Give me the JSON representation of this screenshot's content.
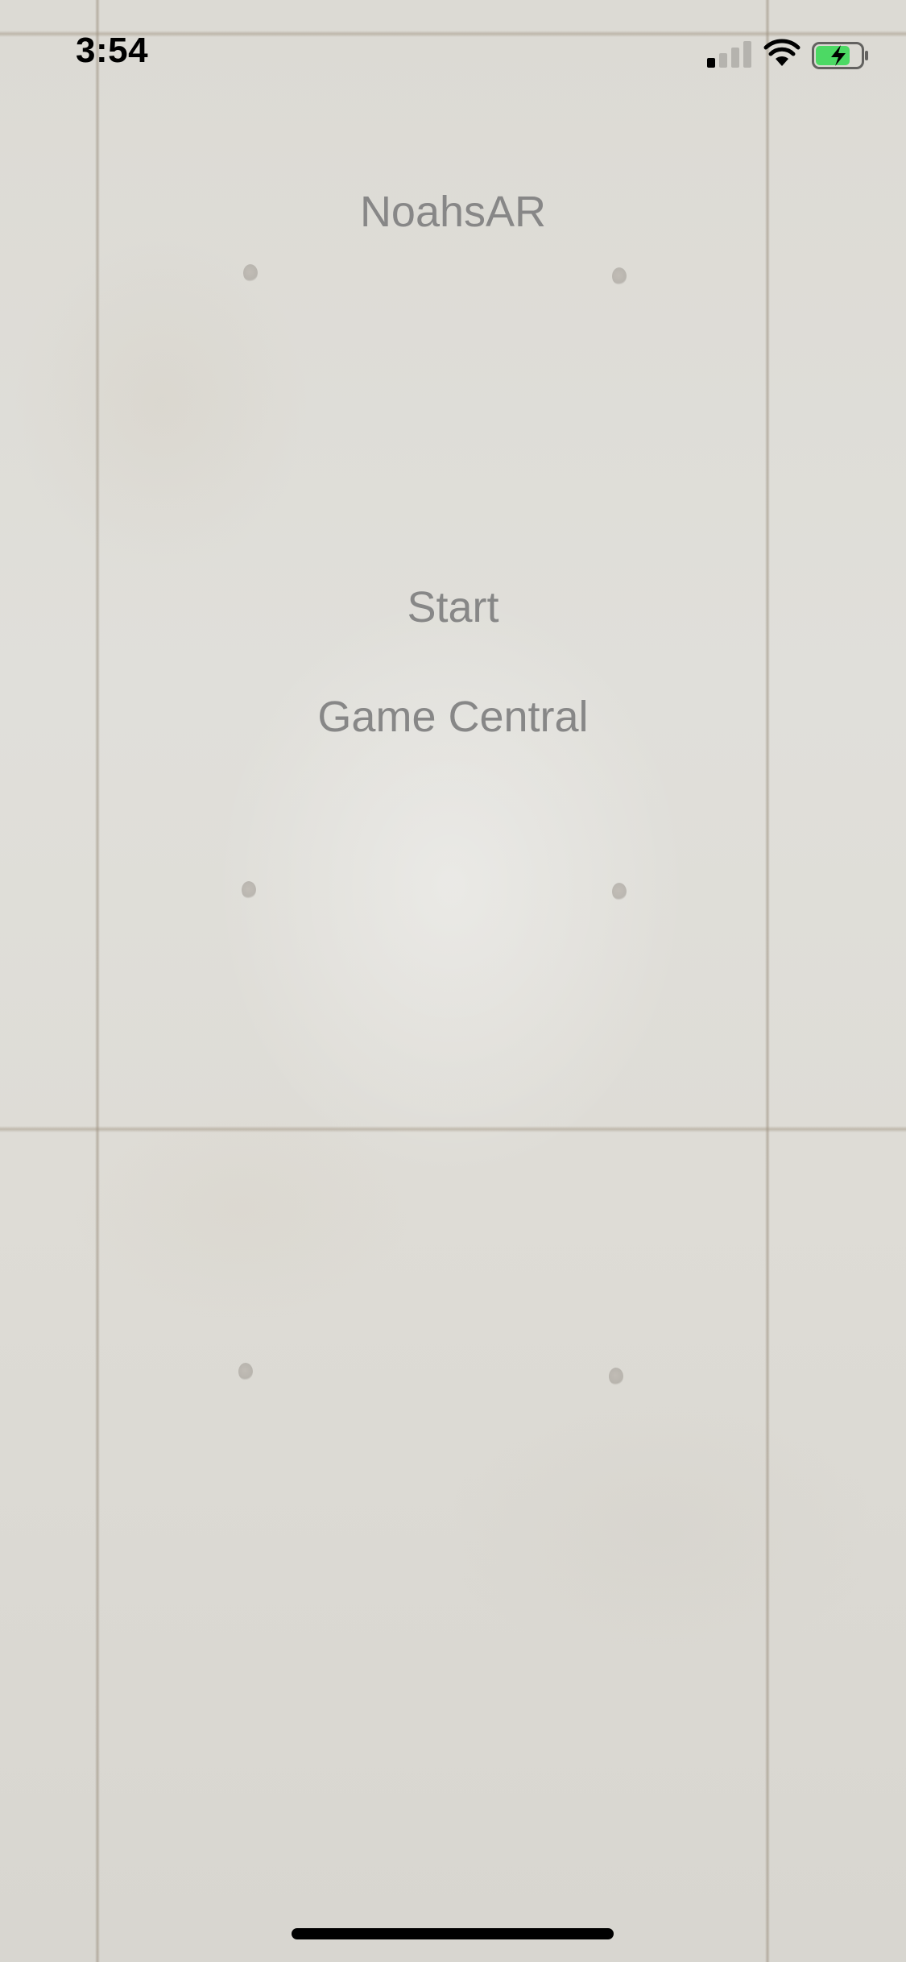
{
  "status_bar": {
    "time": "3:54",
    "signal_icon": "cellular-signal-icon",
    "signal_bars_active": 1,
    "signal_bars_total": 4,
    "wifi_icon": "wifi-icon",
    "battery_icon": "battery-charging-icon",
    "battery_level": 0.75,
    "battery_color": "#4cd964"
  },
  "app": {
    "title": "NoahsAR"
  },
  "menu": {
    "start_label": "Start",
    "game_central_label": "Game Central"
  },
  "colors": {
    "text": "#878787",
    "background": "#dedcd6"
  }
}
